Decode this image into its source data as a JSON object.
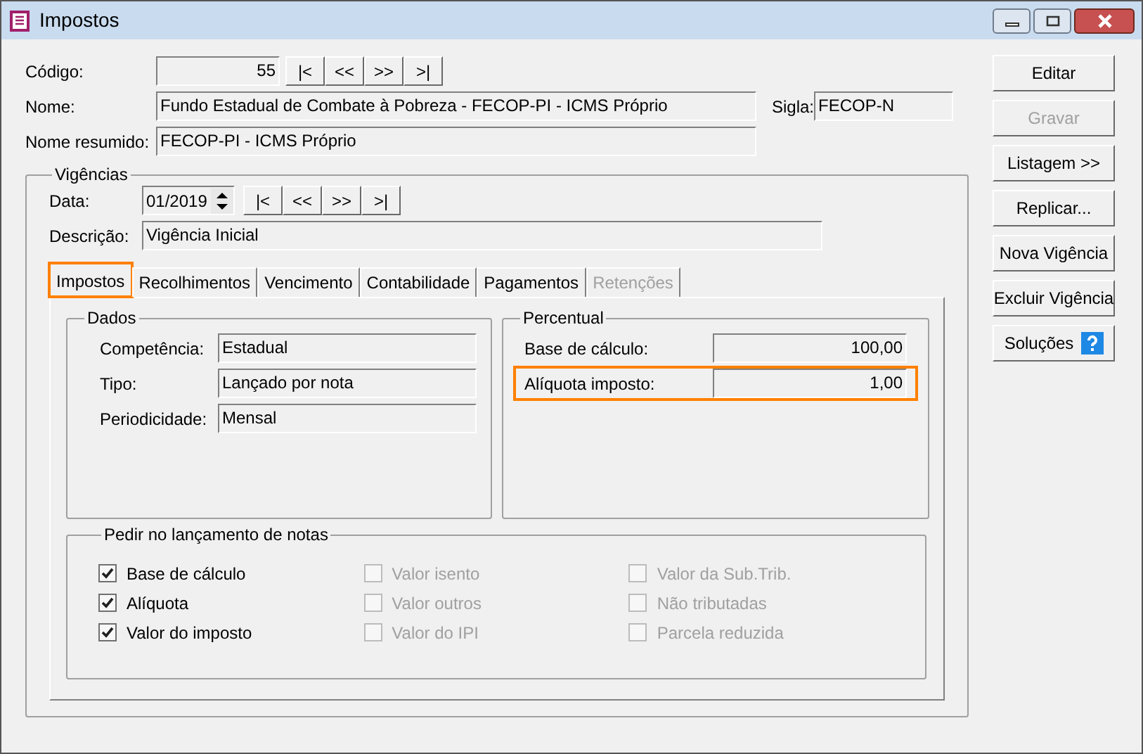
{
  "window": {
    "title": "Impostos"
  },
  "header": {
    "codigo_label": "Código:",
    "codigo": "55",
    "nav": [
      "|<",
      "<<",
      ">>",
      ">|"
    ],
    "nome_label": "Nome:",
    "nome": "Fundo Estadual de Combate à Pobreza - FECOP-PI - ICMS Próprio",
    "sigla_label": "Sigla:",
    "sigla": "FECOP-N",
    "nome_resumido_label": "Nome resumido:",
    "nome_resumido": "FECOP-PI - ICMS Próprio"
  },
  "vigencias": {
    "title": "Vigências",
    "data_label": "Data:",
    "data": "01/2019",
    "nav": [
      "|<",
      "<<",
      ">>",
      ">|"
    ],
    "descricao_label": "Descrição:",
    "descricao": "Vigência Inicial"
  },
  "tabs": [
    {
      "label": "Impostos",
      "selected": true,
      "disabled": false,
      "highlighted": true
    },
    {
      "label": "Recolhimentos",
      "selected": false,
      "disabled": false,
      "highlighted": false
    },
    {
      "label": "Vencimento",
      "selected": false,
      "disabled": false,
      "highlighted": false
    },
    {
      "label": "Contabilidade",
      "selected": false,
      "disabled": false,
      "highlighted": false
    },
    {
      "label": "Pagamentos",
      "selected": false,
      "disabled": false,
      "highlighted": false
    },
    {
      "label": "Retenções",
      "selected": false,
      "disabled": true,
      "highlighted": false
    }
  ],
  "dados": {
    "title": "Dados",
    "fields": [
      {
        "label": "Competência:",
        "value": "Estadual"
      },
      {
        "label": "Tipo:",
        "value": "Lançado por nota"
      },
      {
        "label": "Periodicidade:",
        "value": "Mensal"
      }
    ]
  },
  "percentual": {
    "title": "Percentual",
    "fields": [
      {
        "label": "Base de cálculo:",
        "value": "100,00",
        "highlighted": false
      },
      {
        "label": "Alíquota imposto:",
        "value": "1,00",
        "highlighted": true
      }
    ]
  },
  "pedir": {
    "title": "Pedir no lançamento de notas",
    "columns": [
      [
        {
          "label": "Base de cálculo",
          "checked": true,
          "disabled": false
        },
        {
          "label": "Alíquota",
          "checked": true,
          "disabled": false
        },
        {
          "label": "Valor do imposto",
          "checked": true,
          "disabled": false
        }
      ],
      [
        {
          "label": "Valor isento",
          "checked": false,
          "disabled": true
        },
        {
          "label": "Valor outros",
          "checked": false,
          "disabled": true
        },
        {
          "label": "Valor do IPI",
          "checked": false,
          "disabled": true
        }
      ],
      [
        {
          "label": "Valor da Sub.Trib.",
          "checked": false,
          "disabled": true
        },
        {
          "label": "Não tributadas",
          "checked": false,
          "disabled": true
        },
        {
          "label": "Parcela reduzida",
          "checked": false,
          "disabled": true
        }
      ]
    ]
  },
  "buttons": [
    {
      "label": "Editar",
      "disabled": false,
      "kind": "plain"
    },
    {
      "label": "Gravar",
      "disabled": true,
      "kind": "plain"
    },
    {
      "label": "Listagem >>",
      "disabled": false,
      "kind": "plain"
    },
    {
      "label": "Replicar...",
      "disabled": false,
      "kind": "plain"
    },
    {
      "label": "Nova Vigência",
      "disabled": false,
      "kind": "plain"
    },
    {
      "label": "Excluir Vigência",
      "disabled": false,
      "kind": "plain"
    },
    {
      "label": "Soluções",
      "disabled": false,
      "kind": "help"
    }
  ]
}
